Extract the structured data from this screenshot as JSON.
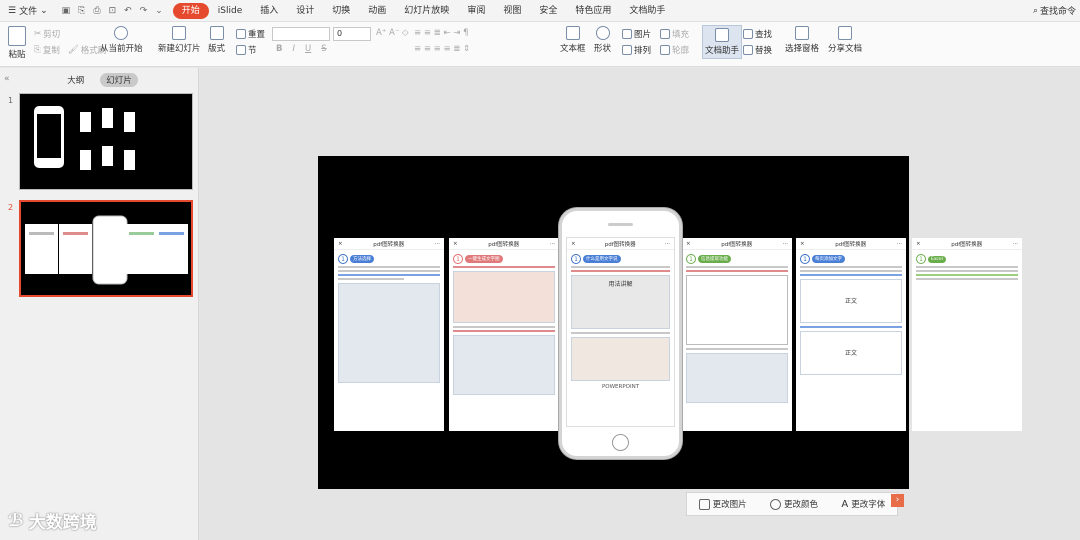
{
  "menu": {
    "file": "文件",
    "tabs": [
      "开始",
      "iSlide",
      "插入",
      "设计",
      "切换",
      "动画",
      "幻灯片放映",
      "审阅",
      "视图",
      "安全",
      "特色应用",
      "文档助手"
    ],
    "active_tab": "开始",
    "search": "查找命令"
  },
  "ribbon": {
    "paste": "粘贴",
    "cut": "剪切",
    "copy": "复制",
    "format_painter": "格式刷",
    "from_current": "从当前开始",
    "new_slide": "新建幻灯片",
    "layout": "版式",
    "reset": "重置",
    "section": "节",
    "font_size": "0",
    "textbox": "文本框",
    "shape": "形状",
    "picture": "图片",
    "fill": "填充",
    "arrange": "排列",
    "outline": "轮廓",
    "doc_assistant": "文档助手",
    "find": "查找",
    "replace": "替换",
    "select_pane": "选择窗格",
    "share_doc": "分享文档",
    "format_buttons": [
      "B",
      "I",
      "U",
      "S"
    ]
  },
  "panel": {
    "tab_outline": "大纲",
    "tab_slides": "幻灯片",
    "collapse": "«",
    "slides": [
      {
        "num": "1"
      },
      {
        "num": "2"
      }
    ]
  },
  "slide": {
    "card_title": "pdf图转换器",
    "close_glyph": "×",
    "more_glyph": "···",
    "cards": [
      {
        "num": "1",
        "label": "方法选择"
      },
      {
        "num": "1",
        "label": "一键生成文字图"
      },
      {
        "num": "1",
        "label": "什么是用文字说"
      },
      {
        "num": "1",
        "label": "信息提取功能"
      },
      {
        "num": "1",
        "label": "每页添加文字"
      },
      {
        "num": "1",
        "label": "Excel"
      }
    ],
    "phone_text": "用法讲解",
    "phone_footer": "POWERPOINT",
    "center_text": "正文"
  },
  "bottom_toolbar": {
    "change_picture": "更改图片",
    "change_color": "更改颜色",
    "change_font": "更改字体",
    "next": "›"
  },
  "watermark": {
    "logo": "ℬ",
    "text": "大数跨境"
  },
  "colors": {
    "accent": "#e64a2e",
    "blue_label": "#4a7fd6",
    "slide_bg": "#000000"
  }
}
